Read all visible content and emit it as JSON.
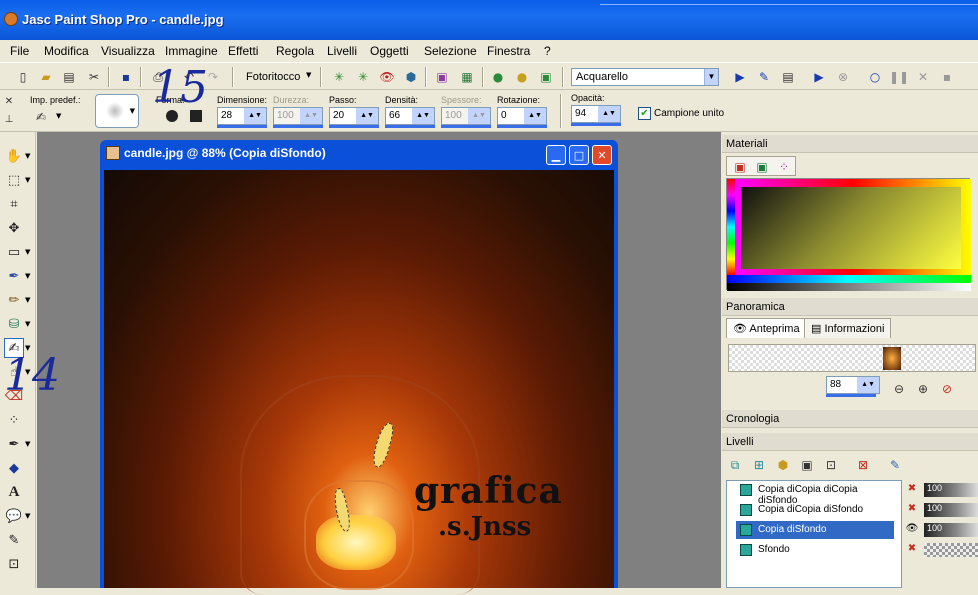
{
  "app": {
    "title": "Jasc Paint Shop Pro - candle.jpg"
  },
  "menu": [
    "File",
    "Modifica",
    "Visualizza",
    "Immagine",
    "Effetti",
    "Regola",
    "Livelli",
    "Oggetti",
    "Selezione",
    "Finestra",
    "?"
  ],
  "toolbar": {
    "photo_label": "Fotoritocco",
    "script_value": "Acquarello"
  },
  "options": {
    "preset_label": "Imp. predef.:",
    "forma_label": "Forma:",
    "dimensione": {
      "label": "Dimensione:",
      "value": "28"
    },
    "durezza": {
      "label": "Durezza:",
      "value": "100"
    },
    "passo": {
      "label": "Passo:",
      "value": "20"
    },
    "densita": {
      "label": "Densità:",
      "value": "66"
    },
    "spessore": {
      "label": "Spessore:",
      "value": "100"
    },
    "rotazione": {
      "label": "Rotazione:",
      "value": "0"
    },
    "opacita": {
      "label": "Opacità:",
      "value": "94"
    },
    "campione": "Campione unito"
  },
  "document": {
    "title": "candle.jpg @ 88% (Copia diSfondo)",
    "watermark_line1": "grafica",
    "watermark_line2": ".s.Jnss"
  },
  "panels": {
    "materiali": "Materiali",
    "panoramica": "Panoramica",
    "tab_anteprima": "Anteprima",
    "tab_informazioni": "Informazioni",
    "zoom_value": "88",
    "cronologia": "Cronologia",
    "livelli": "Livelli"
  },
  "layers": [
    {
      "name": "Copia diCopia diCopia diSfondo",
      "opacity": "100",
      "selected": false
    },
    {
      "name": "Copia diCopia diSfondo",
      "opacity": "100",
      "selected": false
    },
    {
      "name": "Copia diSfondo",
      "opacity": "100",
      "selected": true
    },
    {
      "name": "Sfondo",
      "opacity": "",
      "selected": false
    }
  ],
  "annotations": {
    "num15": "15",
    "num14": "14"
  }
}
